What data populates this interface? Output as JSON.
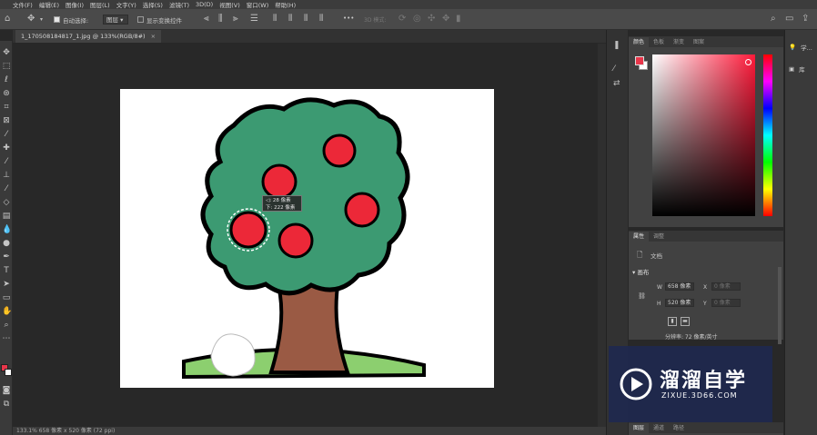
{
  "menu": [
    "文件(F)",
    "编辑(E)",
    "图像(I)",
    "图层(L)",
    "文字(Y)",
    "选择(S)",
    "滤镜(T)",
    "3D(D)",
    "视图(V)",
    "窗口(W)",
    "帮助(H)"
  ],
  "options": {
    "auto_select_label": "自动选择:",
    "auto_select_value": "图层",
    "show_transform_label": "显示变换控件",
    "mode_3d_label": "3D 模式:",
    "more_label": "•••"
  },
  "document": {
    "tab_title": "1_170508184817_1.jpg @ 133%(RGB/8#)",
    "close_label": "×",
    "status": "133.1%     658 像素 x 520 像素 (72 ppi)"
  },
  "tooltip": {
    "line1": "◁: 28 像素",
    "line2": "下: 222 像素"
  },
  "color_panel": {
    "tabs": [
      "颜色",
      "色板",
      "渐变",
      "图案"
    ],
    "foreground": "#e8364a",
    "background": "#ffffff",
    "hue_color": "#ff1a3a"
  },
  "properties_panel": {
    "tabs": [
      "属性",
      "调整"
    ],
    "doc_label": "文档",
    "section_label": "画布",
    "w_label": "W",
    "w_value": "658 像素",
    "h_label": "H",
    "h_value": "520 像素",
    "x_label": "X",
    "x_value": "0 像素",
    "y_label": "Y",
    "y_value": "0 像素",
    "resolution": "分辨率: 72 像素/英寸"
  },
  "layers_panel": {
    "tabs": [
      "图层",
      "通道",
      "路径"
    ]
  },
  "far_panel": {
    "learn_label": "学...",
    "library_label": "库"
  },
  "watermark": {
    "title": "溜溜自学",
    "url": "ZIXUE.3D66.COM"
  }
}
